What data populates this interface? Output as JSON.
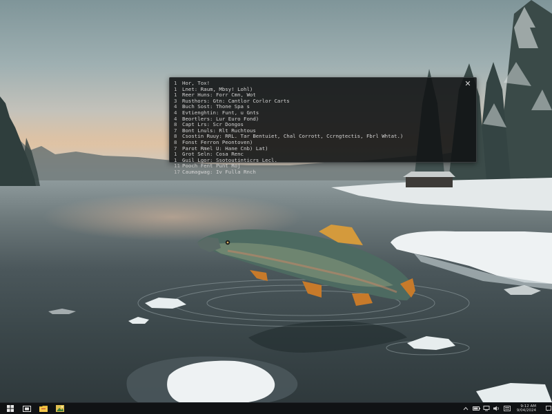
{
  "terminal": {
    "close_glyph": "✕",
    "lines": [
      {
        "num": "1",
        "text": "Hor, Tox!"
      },
      {
        "num": "1",
        "text": "Lnet: Raum, Mbsy! Lohl)"
      },
      {
        "num": "1",
        "text": "Reer Huns: Forr Cmn, Wot"
      },
      {
        "num": "3",
        "text": "Rusthors: Gtn: Cantlor Corlor Carts"
      },
      {
        "num": "4",
        "text": "Buch Sost: Thone Spa s"
      },
      {
        "num": "4",
        "text": "Evtienghtin: Funt, u Gnts"
      },
      {
        "num": "4",
        "text": "Beortlers: Lur Euro Fond)"
      },
      {
        "num": "8",
        "text": "Capt Lrs: Scr Dongos"
      },
      {
        "num": "7",
        "text": "Bont Lnuls: Rlt Ruchtous"
      },
      {
        "num": "8",
        "text": "Csostin Ruuy: RRL. Tar Bentuiet, Chal Corrott, Ccrngtectis, Fbrl Whtat.)"
      },
      {
        "num": "8",
        "text": "Fonst Ferron Peontoven)"
      },
      {
        "num": "7",
        "text": "Parot Rmel U: Hane Cnb) Lat)"
      },
      {
        "num": "1",
        "text": "Grot Seln: Cosa Renc"
      },
      {
        "num": "1",
        "text": "Guil Lgor: Ssotoutinticrs Lecl."
      },
      {
        "num": "11",
        "text": "Pooch Fent Punt Roj"
      },
      {
        "num": "17",
        "text": "Caumagwag: Iv Fulla Rnch"
      }
    ]
  },
  "taskbar": {
    "clock_time": "9:12 AM",
    "clock_date": "9/04/2024"
  },
  "colors": {
    "terminal_bg": "#121415",
    "terminal_text": "#d4d4d4",
    "taskbar_bg": "#101214"
  }
}
